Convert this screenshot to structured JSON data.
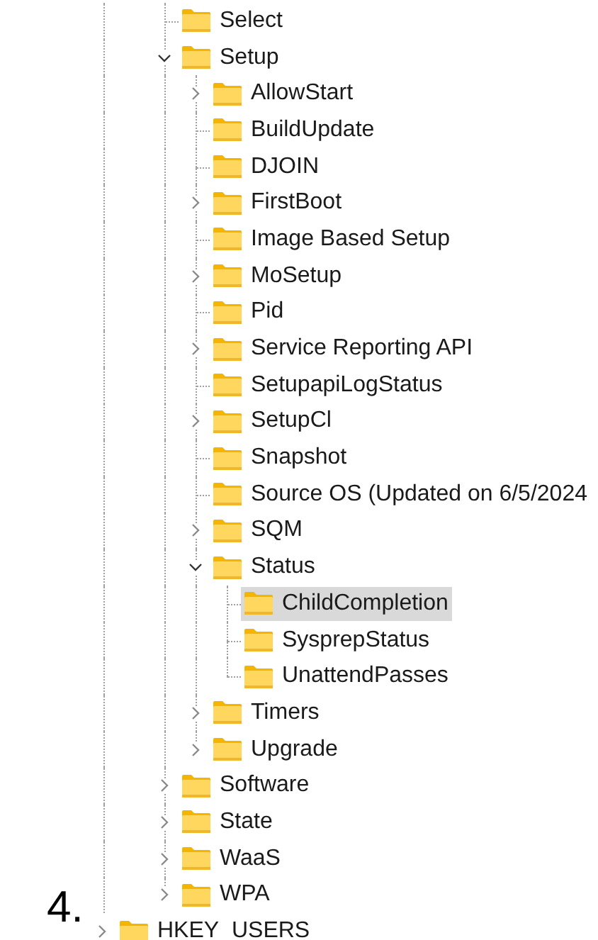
{
  "tree": {
    "subtree": [
      {
        "label": "Select",
        "kind": "leaf",
        "selected": false
      },
      {
        "label": "Setup",
        "kind": "expandable",
        "expanded": true,
        "selected": false,
        "children": [
          {
            "label": "AllowStart",
            "kind": "expandable",
            "expanded": false,
            "selected": false
          },
          {
            "label": "BuildUpdate",
            "kind": "leaf",
            "selected": false
          },
          {
            "label": "DJOIN",
            "kind": "leaf",
            "selected": false
          },
          {
            "label": "FirstBoot",
            "kind": "expandable",
            "expanded": false,
            "selected": false
          },
          {
            "label": "Image Based Setup",
            "kind": "leaf",
            "selected": false
          },
          {
            "label": "MoSetup",
            "kind": "expandable",
            "expanded": false,
            "selected": false
          },
          {
            "label": "Pid",
            "kind": "leaf",
            "selected": false
          },
          {
            "label": "Service Reporting API",
            "kind": "expandable",
            "expanded": false,
            "selected": false
          },
          {
            "label": "SetupapiLogStatus",
            "kind": "leaf",
            "selected": false
          },
          {
            "label": "SetupCl",
            "kind": "expandable",
            "expanded": false,
            "selected": false
          },
          {
            "label": "Snapshot",
            "kind": "leaf",
            "selected": false
          },
          {
            "label": "Source OS (Updated on 6/5/2024",
            "kind": "leaf",
            "selected": false
          },
          {
            "label": "SQM",
            "kind": "expandable",
            "expanded": false,
            "selected": false
          },
          {
            "label": "Status",
            "kind": "expandable",
            "expanded": true,
            "selected": false,
            "children": [
              {
                "label": "ChildCompletion",
                "kind": "leaf",
                "selected": true
              },
              {
                "label": "SysprepStatus",
                "kind": "leaf",
                "selected": false
              },
              {
                "label": "UnattendPasses",
                "kind": "leaf",
                "selected": false
              }
            ]
          },
          {
            "label": "Timers",
            "kind": "expandable",
            "expanded": false,
            "selected": false
          },
          {
            "label": "Upgrade",
            "kind": "expandable",
            "expanded": false,
            "selected": false
          }
        ]
      },
      {
        "label": "Software",
        "kind": "expandable",
        "expanded": false,
        "selected": false
      },
      {
        "label": "State",
        "kind": "expandable",
        "expanded": false,
        "selected": false
      },
      {
        "label": "WaaS",
        "kind": "expandable",
        "expanded": false,
        "selected": false
      },
      {
        "label": "WPA",
        "kind": "expandable",
        "expanded": false,
        "selected": false
      }
    ],
    "root_items": [
      {
        "label": "HKEY_USERS",
        "kind": "expandable",
        "expanded": false,
        "selected": false
      }
    ]
  },
  "annotation": "4."
}
